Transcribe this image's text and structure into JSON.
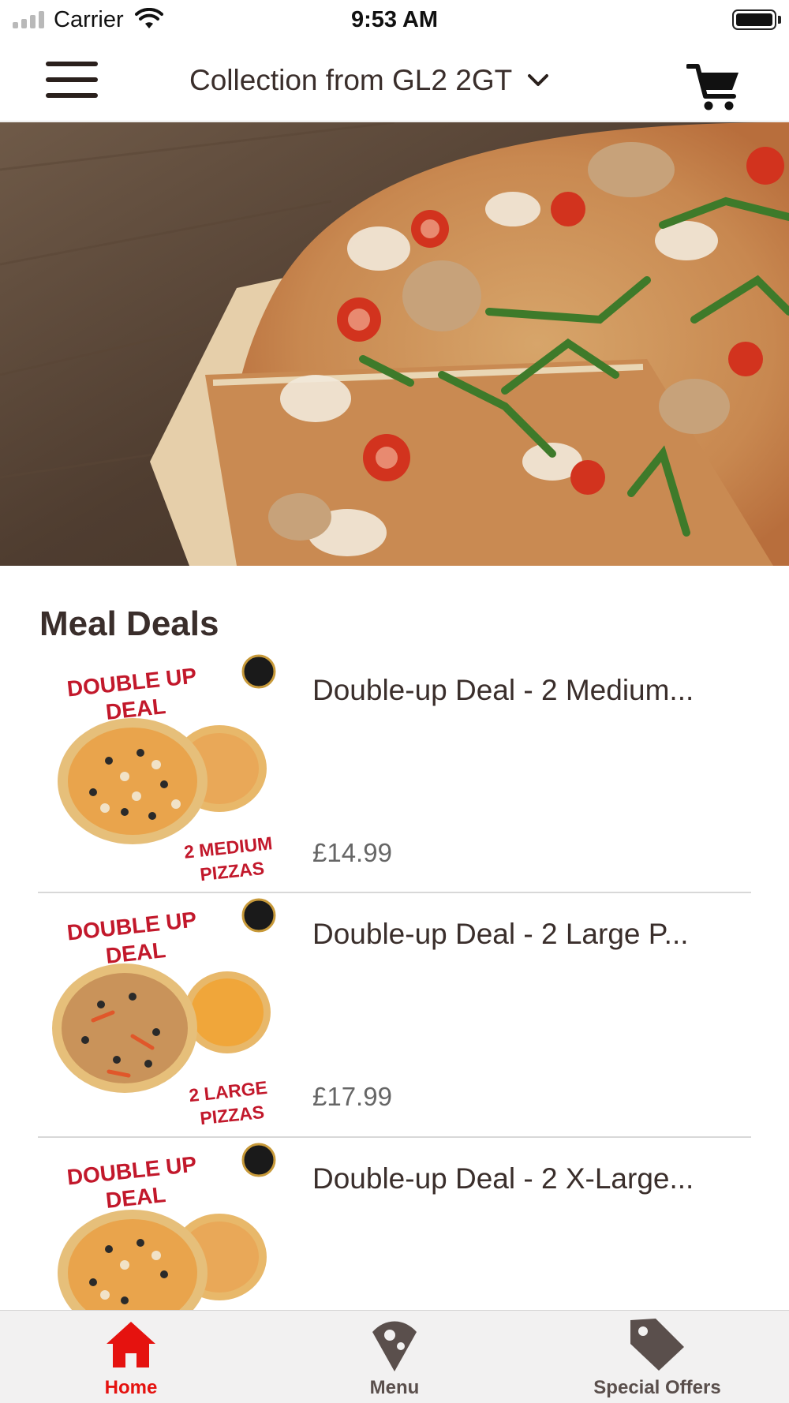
{
  "status_bar": {
    "carrier": "Carrier",
    "time": "9:53 AM",
    "battery_level": 1.0
  },
  "navbar": {
    "title": "Collection from GL2 2GT",
    "menu_icon": "hamburger-menu-icon",
    "dropdown_icon": "chevron-down-icon",
    "cart_icon": "cart-icon"
  },
  "hero": {
    "image": "pizza-on-wooden-board-photo"
  },
  "meal_deals": {
    "title": "Meal Deals",
    "items": [
      {
        "name": "Double-up Deal - 2 Medium...",
        "price": "£14.99",
        "image_heading_1": "DOUBLE UP",
        "image_heading_2": "DEAL",
        "image_caption_1": "2 MEDIUM",
        "image_caption_2": "PIZZAS"
      },
      {
        "name": "Double-up Deal - 2 Large P...",
        "price": "£17.99",
        "image_heading_1": "DOUBLE UP",
        "image_heading_2": "DEAL",
        "image_caption_1": "2 LARGE",
        "image_caption_2": "PIZZAS"
      },
      {
        "name": "Double-up Deal - 2 X-Large...",
        "price": "",
        "image_heading_1": "DOUBLE UP",
        "image_heading_2": "DEAL",
        "image_caption_1": "",
        "image_caption_2": ""
      }
    ]
  },
  "tabbar": {
    "tabs": [
      {
        "label": "Home",
        "icon": "home-icon",
        "active": true
      },
      {
        "label": "Menu",
        "icon": "menu-pizza-slice-icon",
        "active": false
      },
      {
        "label": "Special Offers",
        "icon": "tag-icon",
        "active": false
      }
    ]
  },
  "colors": {
    "active_tab": "#e5120f",
    "inactive_tab": "#5a4f4c",
    "deal_text_red": "#c2182b",
    "text_dark": "#3a2e2b"
  }
}
